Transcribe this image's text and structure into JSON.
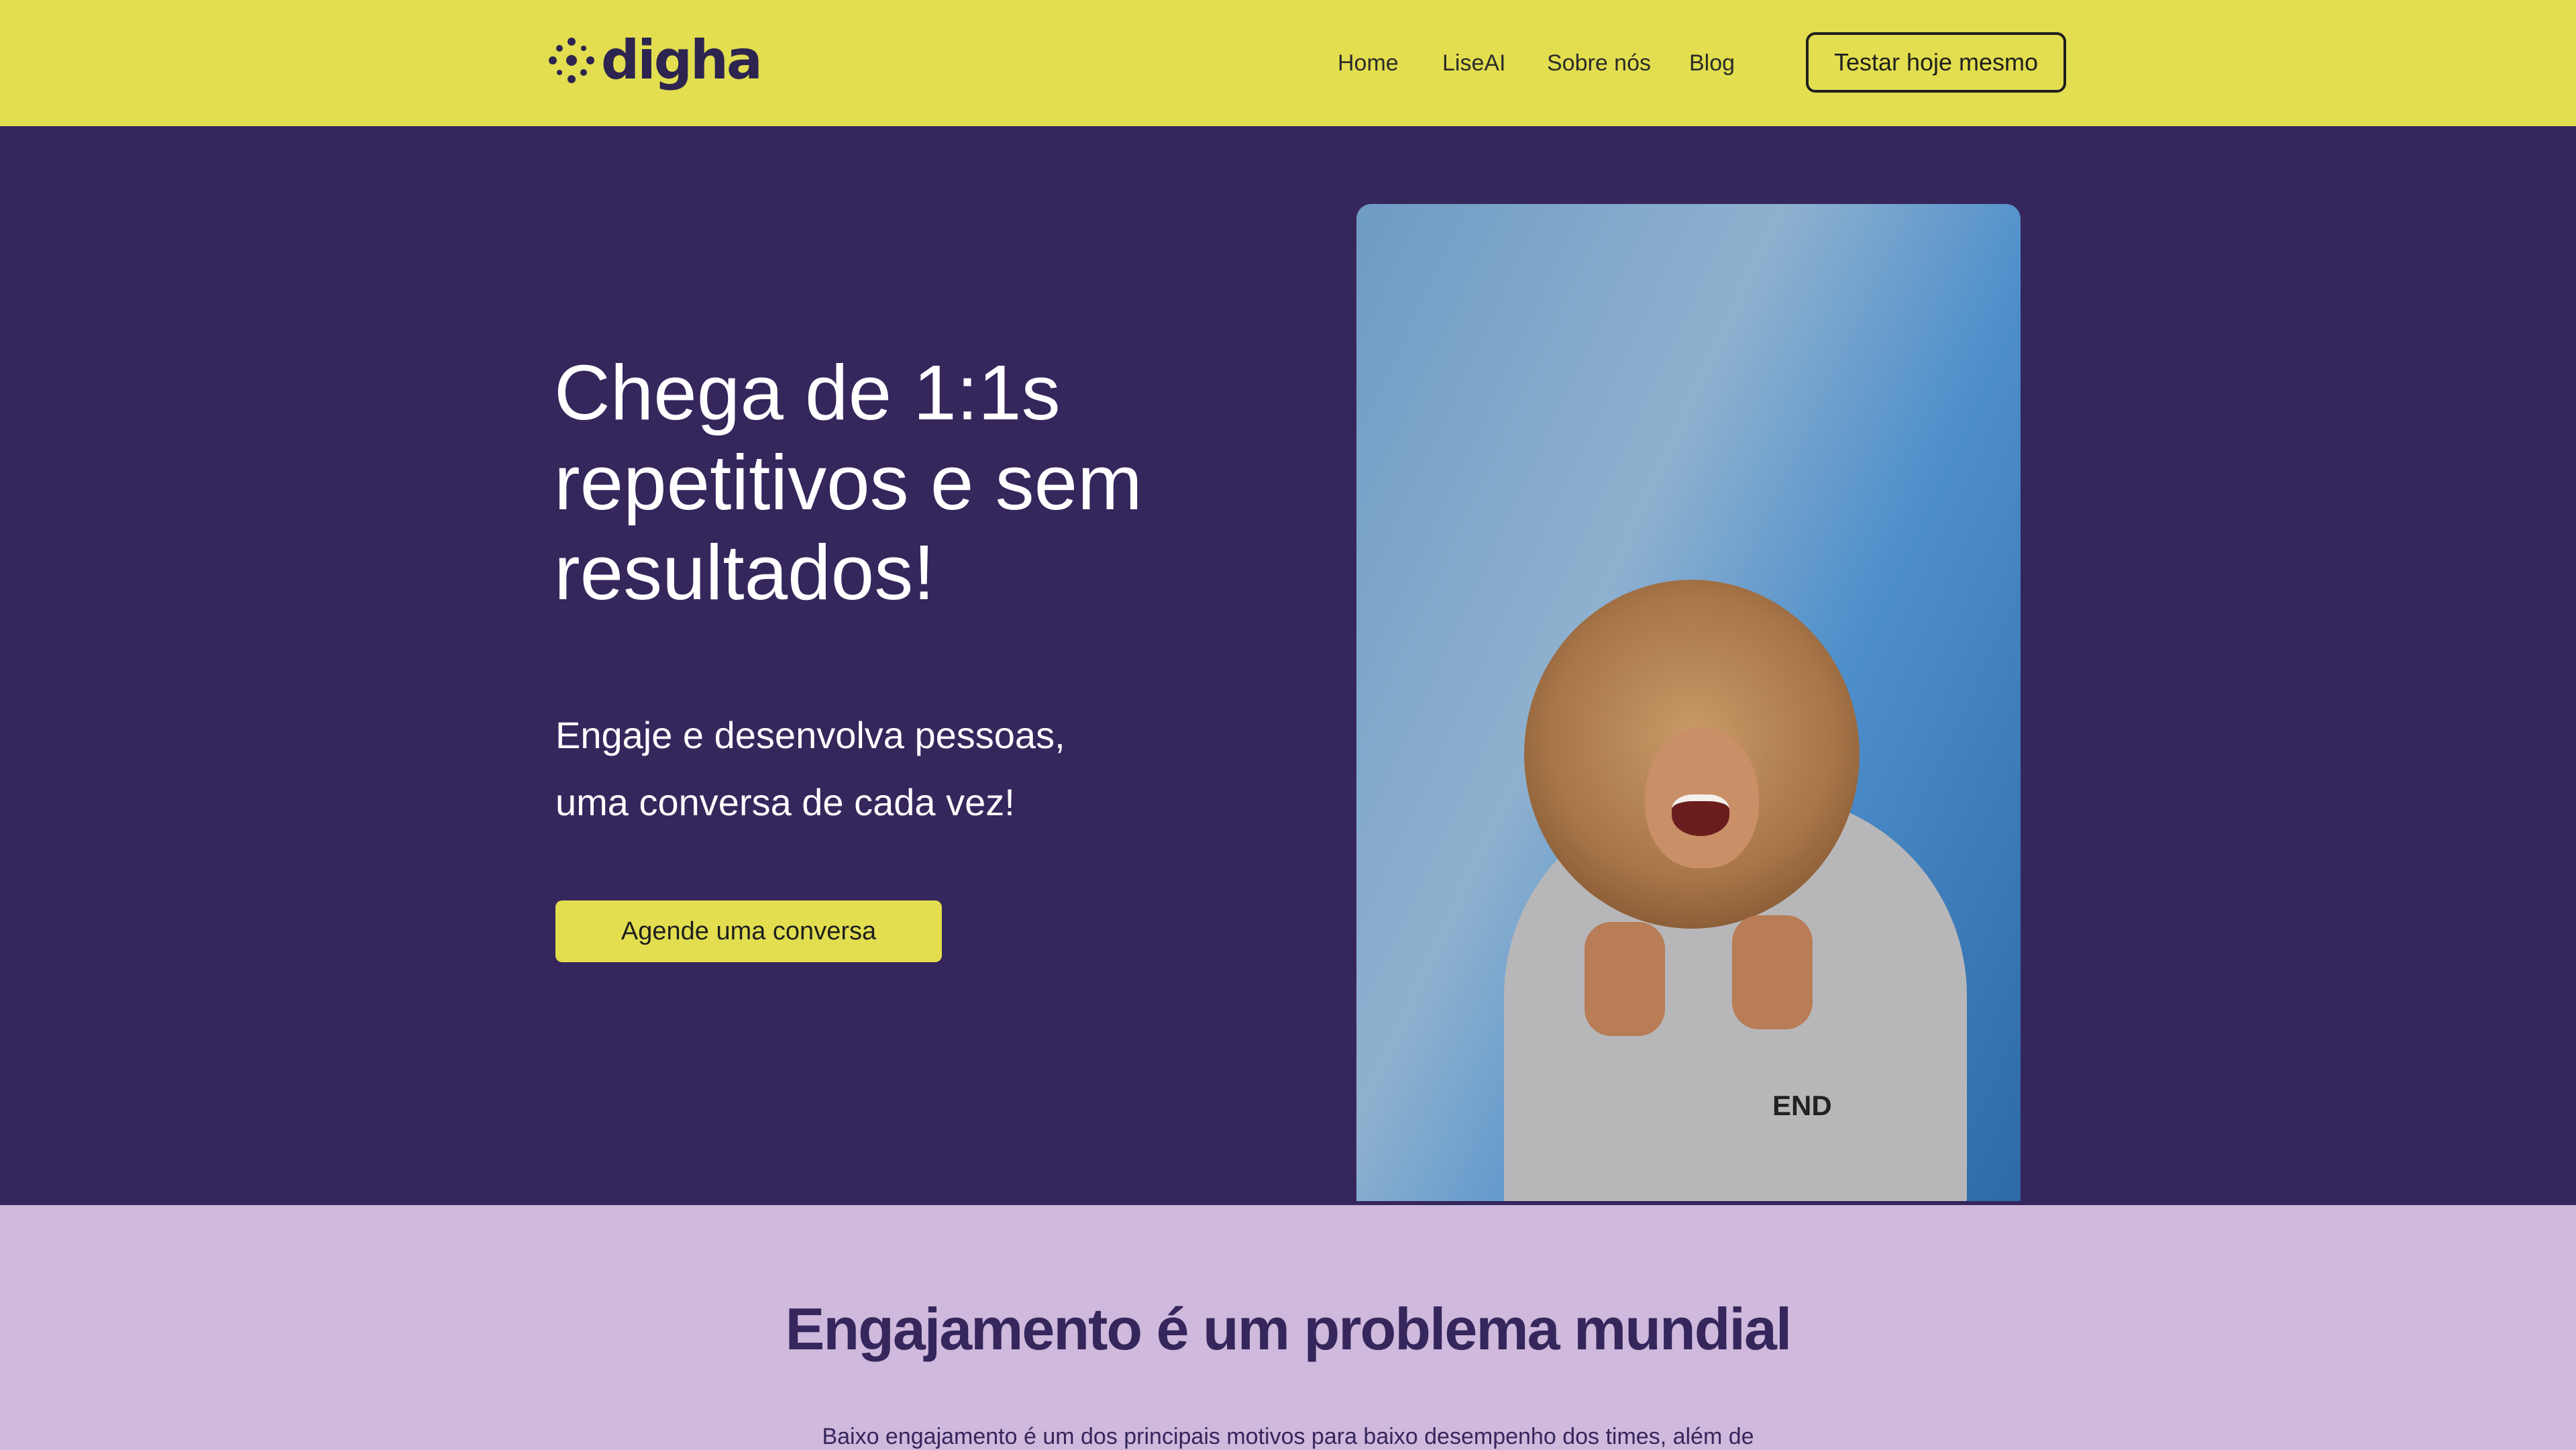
{
  "header": {
    "brand": "digha",
    "nav": [
      "Home",
      "LiseAI",
      "Sobre nós",
      "Blog"
    ],
    "cta_label": "Testar hoje mesmo"
  },
  "hero": {
    "title_lines": [
      "Chega de 1:1s",
      "repetitivos e sem",
      "resultados!"
    ],
    "subtitle_lines": [
      "Engaje e desenvolva pessoas,",
      "uma conversa de cada vez!"
    ],
    "button_label": "Agende uma conversa",
    "photo_shirt_text": "END"
  },
  "problem": {
    "title": "Engajamento é um problema mundial",
    "text": "Baixo engajamento é um dos principais motivos para baixo desempenho dos times, além de"
  },
  "colors": {
    "topbar": "#e2de4f",
    "hero_bg": "#35265c",
    "section_bg": "#cfb9dc",
    "accent": "#e2de4f"
  },
  "icons": {
    "logo": "digha-logo-icon"
  }
}
